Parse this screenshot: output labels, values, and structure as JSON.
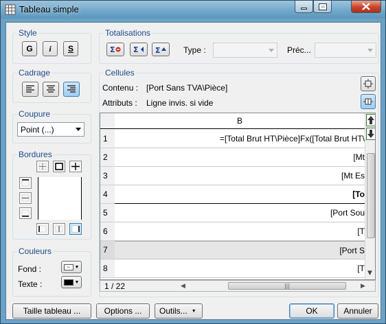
{
  "window": {
    "title": "Tableau simple"
  },
  "style": {
    "label": "Style",
    "bold": "G",
    "italic": "i",
    "underline": "S"
  },
  "totalisations": {
    "label": "Totalisations",
    "type_label": "Type :",
    "prec_label": "Préc..."
  },
  "cadrage": {
    "label": "Cadrage"
  },
  "cellules": {
    "label": "Cellules",
    "contenu_label": "Contenu :",
    "contenu_value": "[Port Sans TVA\\Pièce]",
    "attributs_label": "Attributs :",
    "attributs_value": "Ligne invis. si vide"
  },
  "coupure": {
    "label": "Coupure",
    "selected": "Point (...)"
  },
  "bordures": {
    "label": "Bordures"
  },
  "couleurs": {
    "label": "Couleurs",
    "fond_label": "Fond :",
    "texte_label": "Texte :",
    "texte_color": "#000000"
  },
  "grid": {
    "column_header": "B",
    "rows": [
      {
        "n": "1",
        "text": "=[Total Brut HT\\Pièce]Fx([Total Brut HT\\",
        "bold": false
      },
      {
        "n": "2",
        "text": "[Mt",
        "bold": false
      },
      {
        "n": "3",
        "text": "[Mt Es",
        "bold": false
      },
      {
        "n": "4",
        "text": "[To",
        "bold": true
      },
      {
        "n": "5",
        "text": "[Port Sou",
        "bold": false
      },
      {
        "n": "6",
        "text": "[T",
        "bold": false
      },
      {
        "n": "7",
        "text": "[Port S",
        "bold": false
      },
      {
        "n": "8",
        "text": "[T",
        "bold": false
      }
    ],
    "selected_row": "7"
  },
  "pager": {
    "value": "1 / 22"
  },
  "bottom": {
    "taille": "Taille tableau ...",
    "options": "Options ...",
    "outils": "Outils...",
    "ok": "OK",
    "annuler": "Annuler"
  },
  "colors": {
    "accent": "#1a4b8c",
    "title_bar": "#6fa6c9",
    "selected_row": "#e6e6e6"
  }
}
